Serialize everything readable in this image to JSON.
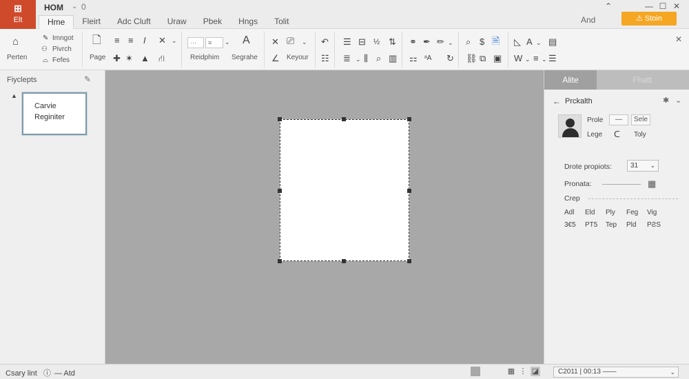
{
  "app": {
    "file_icon": "⊞",
    "file_label": "Elt",
    "doc_title": "HOM",
    "doc_version": "0",
    "quick_access_icon": "⌄",
    "tabs": [
      "Hme",
      "Fleirt",
      "Adc Cluft",
      "Uraw",
      "Pbek",
      "Hngs",
      "Tolit"
    ],
    "active_tab_index": 0,
    "right_label": "And",
    "start_button": "⚠ Stoin",
    "accent_color": "#cf4a2b",
    "start_color": "#f5a623"
  },
  "ribbon": {
    "paste_label": "Perten",
    "clip_items": [
      "Imngot",
      "Pivrch",
      "Fefes"
    ],
    "page_label": "Page",
    "group3_dropdown1": "⋯",
    "group3_dropdown2": "≡",
    "rhythm_label": "Reidphim",
    "segraphe_label": "Segrahe",
    "keyour_label": "Keyour"
  },
  "left_pane": {
    "title": "Fiyclepts",
    "slide_lines": [
      "Carvie",
      "Reginiter"
    ]
  },
  "right_pane": {
    "tab_active": "Alite",
    "tab_inactive": "Fhatt",
    "panel_title": "Prckalth",
    "prop1_label": "Prole",
    "prop1_value": "—",
    "prop1_extra": "Sele",
    "prop2_label": "Lege",
    "prop2_value": "ᑕ",
    "prop2_extra": "Toly",
    "drote_label": "Drote propiots:",
    "drote_value": "31",
    "pronata_label": "Pronata:",
    "crop_label": "Crep",
    "stat_row1": [
      "Adl",
      "Eld",
      "Ply",
      "Feg",
      "Vig"
    ],
    "stat_row2": [
      "3€5",
      "PT5",
      "Tep",
      "Pld",
      "PƧS"
    ]
  },
  "statusbar": {
    "left_text": "Csary lint",
    "info_icon": "ⓘ",
    "left_extra": "— Atd",
    "zoom_text": "C2011 | 00:13 ——"
  }
}
